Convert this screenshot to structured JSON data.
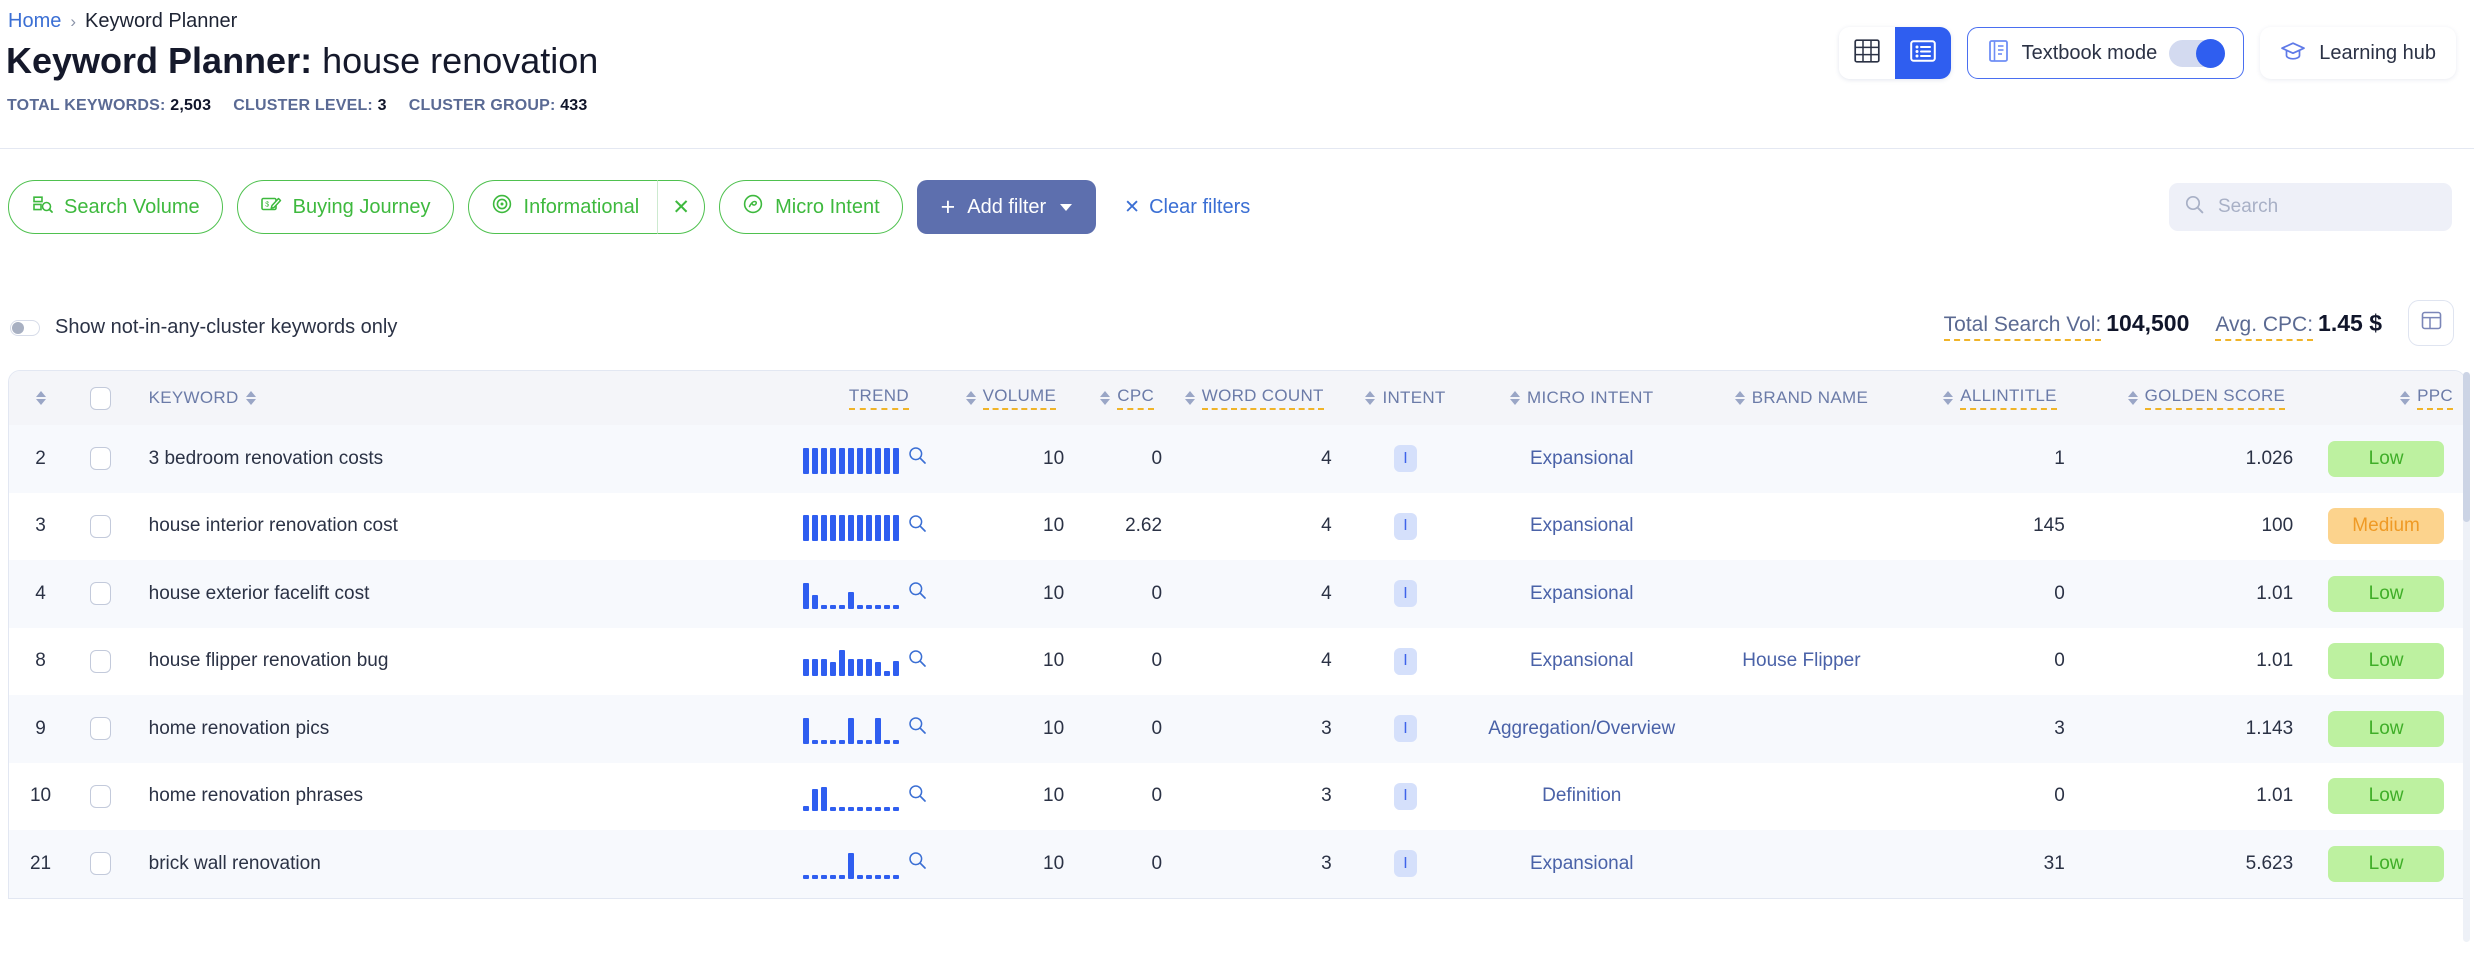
{
  "breadcrumb": {
    "home": "Home",
    "separator": "›",
    "current": "Keyword Planner"
  },
  "title": {
    "prefix": "Keyword Planner:",
    "subject": "house renovation"
  },
  "meta": [
    {
      "label": "TOTAL KEYWORDS:",
      "value": "2,503"
    },
    {
      "label": "CLUSTER LEVEL:",
      "value": "3"
    },
    {
      "label": "CLUSTER GROUP:",
      "value": "433"
    }
  ],
  "header_right": {
    "view_grid_icon": "table-grid-icon",
    "view_list_icon": "list-view-icon",
    "textbook_label": "Textbook mode",
    "textbook_on": true,
    "learning_hub_label": "Learning hub"
  },
  "filters": {
    "chips": [
      {
        "label": "Search Volume",
        "icon": "search-volume-icon",
        "removable": false
      },
      {
        "label": "Buying Journey",
        "icon": "buying-journey-icon",
        "removable": false
      },
      {
        "label": "Informational",
        "icon": "target-icon",
        "removable": true,
        "remove_glyph": "✕"
      },
      {
        "label": "Micro Intent",
        "icon": "micro-intent-icon",
        "removable": false
      }
    ],
    "add_filter_label": "Add filter",
    "add_filter_plus": "+",
    "clear_filters_label": "Clear filters",
    "clear_filters_glyph": "✕",
    "add_filter_color": "#5d6fae",
    "chip_color": "#3eb93e"
  },
  "search": {
    "placeholder": "Search",
    "value": "",
    "icon": "search-icon"
  },
  "subbar": {
    "toggle_label": "Show not-in-any-cluster keywords only",
    "toggle_on": false,
    "stats": [
      {
        "label": "Total Search Vol:",
        "value": "104,500"
      },
      {
        "label": "Avg. CPC:",
        "value": "1.45 $"
      }
    ],
    "columns_button_icon": "column-settings-icon"
  },
  "table": {
    "columns": [
      {
        "key": "idx",
        "label": "",
        "sortable": true,
        "align": "c",
        "dashed": false
      },
      {
        "key": "check",
        "label": "",
        "sortable": false,
        "align": "c",
        "dashed": false
      },
      {
        "key": "keyword",
        "label": "KEYWORD",
        "sortable": true,
        "align": "l",
        "dashed": false
      },
      {
        "key": "trend",
        "label": "TREND",
        "sortable": false,
        "align": "r",
        "dashed": true
      },
      {
        "key": "volume",
        "label": "VOLUME",
        "sortable": true,
        "align": "r",
        "dashed": true
      },
      {
        "key": "cpc",
        "label": "CPC",
        "sortable": true,
        "align": "r",
        "dashed": true
      },
      {
        "key": "word_count",
        "label": "WORD COUNT",
        "sortable": true,
        "align": "r",
        "dashed": true
      },
      {
        "key": "intent",
        "label": "INTENT",
        "sortable": true,
        "align": "c",
        "dashed": false
      },
      {
        "key": "micro",
        "label": "MICRO INTENT",
        "sortable": true,
        "align": "c",
        "dashed": false
      },
      {
        "key": "brand",
        "label": "BRAND NAME",
        "sortable": true,
        "align": "c",
        "dashed": false
      },
      {
        "key": "allintitle",
        "label": "ALLINTITLE",
        "sortable": true,
        "align": "r",
        "dashed": true
      },
      {
        "key": "golden",
        "label": "GOLDEN SCORE",
        "sortable": true,
        "align": "r",
        "dashed": true
      },
      {
        "key": "ppc",
        "label": "PPC",
        "sortable": true,
        "align": "r",
        "dashed": true
      }
    ],
    "rows": [
      {
        "idx": "2",
        "keyword": "3 bedroom renovation costs",
        "trend": [
          26,
          26,
          26,
          26,
          26,
          26,
          26,
          26,
          26,
          26,
          26
        ],
        "volume": "10",
        "cpc": "0",
        "word_count": "4",
        "intent": "I",
        "micro": "Expansional",
        "brand": "",
        "allintitle": "1",
        "golden": "1.026",
        "ppc": "Low",
        "ppc_level": "low"
      },
      {
        "idx": "3",
        "keyword": "house interior renovation cost",
        "trend": [
          26,
          26,
          26,
          26,
          26,
          26,
          26,
          26,
          26,
          26,
          26
        ],
        "volume": "10",
        "cpc": "2.62",
        "word_count": "4",
        "intent": "I",
        "micro": "Expansional",
        "brand": "",
        "allintitle": "145",
        "golden": "100",
        "ppc": "Medium",
        "ppc_level": "medium"
      },
      {
        "idx": "4",
        "keyword": "house exterior facelift cost",
        "trend": [
          26,
          14,
          4,
          4,
          4,
          17,
          4,
          4,
          4,
          4,
          4
        ],
        "volume": "10",
        "cpc": "0",
        "word_count": "4",
        "intent": "I",
        "micro": "Expansional",
        "brand": "",
        "allintitle": "0",
        "golden": "1.01",
        "ppc": "Low",
        "ppc_level": "low"
      },
      {
        "idx": "8",
        "keyword": "house flipper renovation bug",
        "trend": [
          17,
          17,
          17,
          14,
          26,
          17,
          17,
          17,
          14,
          5,
          15
        ],
        "volume": "10",
        "cpc": "0",
        "word_count": "4",
        "intent": "I",
        "micro": "Expansional",
        "brand": "House Flipper",
        "allintitle": "0",
        "golden": "1.01",
        "ppc": "Low",
        "ppc_level": "low"
      },
      {
        "idx": "9",
        "keyword": "home renovation pics",
        "trend": [
          26,
          4,
          4,
          4,
          4,
          26,
          4,
          4,
          26,
          4,
          4
        ],
        "volume": "10",
        "cpc": "0",
        "word_count": "3",
        "intent": "I",
        "micro": "Aggregation/Overview",
        "brand": "",
        "allintitle": "3",
        "golden": "1.143",
        "ppc": "Low",
        "ppc_level": "low"
      },
      {
        "idx": "10",
        "keyword": "home renovation phrases",
        "trend": [
          5,
          22,
          24,
          4,
          4,
          4,
          4,
          4,
          4,
          4,
          4
        ],
        "volume": "10",
        "cpc": "0",
        "word_count": "3",
        "intent": "I",
        "micro": "Definition",
        "brand": "",
        "allintitle": "0",
        "golden": "1.01",
        "ppc": "Low",
        "ppc_level": "low"
      },
      {
        "idx": "21",
        "keyword": "brick wall renovation",
        "trend": [
          4,
          4,
          4,
          4,
          4,
          26,
          4,
          4,
          4,
          4,
          4
        ],
        "volume": "10",
        "cpc": "0",
        "word_count": "3",
        "intent": "I",
        "micro": "Expansional",
        "brand": "",
        "allintitle": "31",
        "golden": "5.623",
        "ppc": "Low",
        "ppc_level": "low"
      }
    ]
  }
}
